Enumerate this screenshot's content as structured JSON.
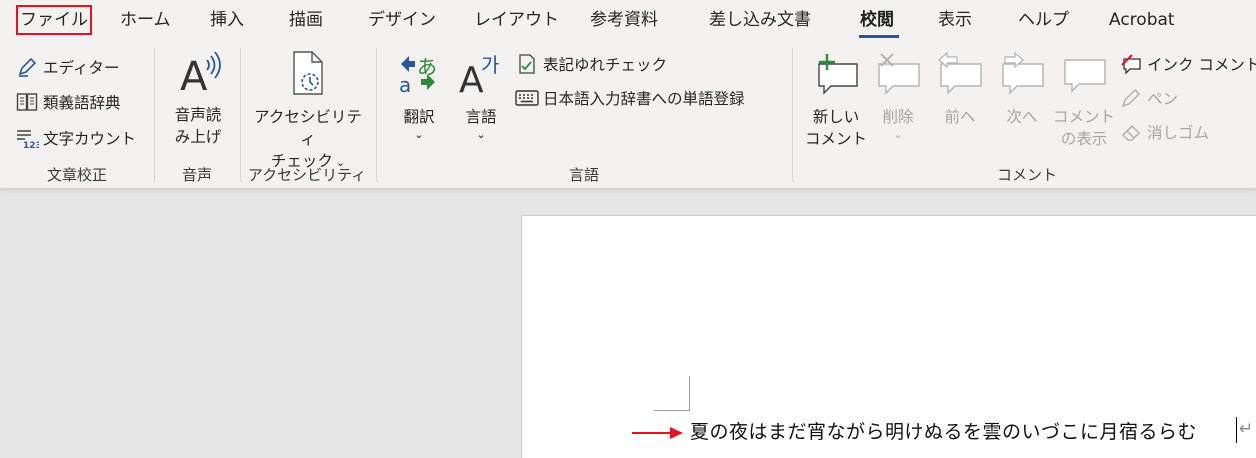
{
  "tabs": {
    "file": "ファイル",
    "home": "ホーム",
    "insert": "挿入",
    "draw": "描画",
    "design": "デザイン",
    "layout": "レイアウト",
    "references": "参考資料",
    "mailings": "差し込み文書",
    "review": "校閲",
    "view": "表示",
    "help": "ヘルプ",
    "acrobat": "Acrobat"
  },
  "groups": {
    "proofing": {
      "label": "文章校正",
      "editor": "エディター",
      "thesaurus": "類義語辞典",
      "word_count": "文字カウント"
    },
    "speech": {
      "label": "音声",
      "read_aloud_1": "音声読",
      "read_aloud_2": "み上げ"
    },
    "accessibility": {
      "label": "アクセシビリティ",
      "check_1": "アクセシビリティ",
      "check_2": "チェック"
    },
    "language": {
      "label": "言語",
      "translate": "翻訳",
      "language": "言語",
      "consistency": "表記ゆれチェック",
      "ime_dictionary": "日本語入力辞書への単語登録"
    },
    "comments": {
      "label": "コメント",
      "new_1": "新しい",
      "new_2": "コメント",
      "delete": "削除",
      "previous": "前へ",
      "next": "次へ",
      "show_1": "コメント",
      "show_2": "の表示",
      "ink_comment": "インク コメント",
      "pen": "ペン",
      "eraser": "消しゴム"
    }
  },
  "document": {
    "text": "夏の夜はまだ宵ながら明けぬるを雲のいづこに月宿るらむ",
    "paragraph_mark": "↵"
  },
  "colors": {
    "accent": "#2b579a",
    "highlight_box": "#e81123",
    "arrow": "#e81123",
    "green_icon": "#2e8b3a",
    "blue_icon": "#2b579a"
  }
}
